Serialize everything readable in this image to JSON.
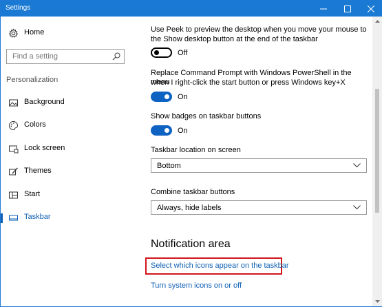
{
  "window": {
    "title": "Settings"
  },
  "sidebar": {
    "home_label": "Home",
    "search_placeholder": "Find a setting",
    "section_label": "Personalization",
    "items": [
      {
        "label": "Background",
        "icon": "picture-icon"
      },
      {
        "label": "Colors",
        "icon": "palette-icon"
      },
      {
        "label": "Lock screen",
        "icon": "lock-screen-icon"
      },
      {
        "label": "Themes",
        "icon": "brush-icon"
      },
      {
        "label": "Start",
        "icon": "start-tiles-icon"
      },
      {
        "label": "Taskbar",
        "icon": "taskbar-icon",
        "active": true
      }
    ]
  },
  "main": {
    "peek": {
      "text_line1": "Use Peek to preview the desktop when you move your mouse to",
      "text_line2": "the Show desktop button at the end of the taskbar",
      "state": "Off"
    },
    "powershell": {
      "text_line1": "Replace Command Prompt with Windows PowerShell in the menu",
      "text_line2": "when I right-click the start button or press Windows key+X",
      "state": "On"
    },
    "badges": {
      "text": "Show badges on taskbar buttons",
      "state": "On"
    },
    "location": {
      "label": "Taskbar location on screen",
      "value": "Bottom"
    },
    "combine": {
      "label": "Combine taskbar buttons",
      "value": "Always, hide labels"
    },
    "notification_heading": "Notification area",
    "link_icons": "Select which icons appear on the taskbar",
    "link_system": "Turn system icons on or off"
  },
  "colors": {
    "accent": "#0e5fb4",
    "titlebar": "#1979d3",
    "highlight": "#d0141b"
  }
}
